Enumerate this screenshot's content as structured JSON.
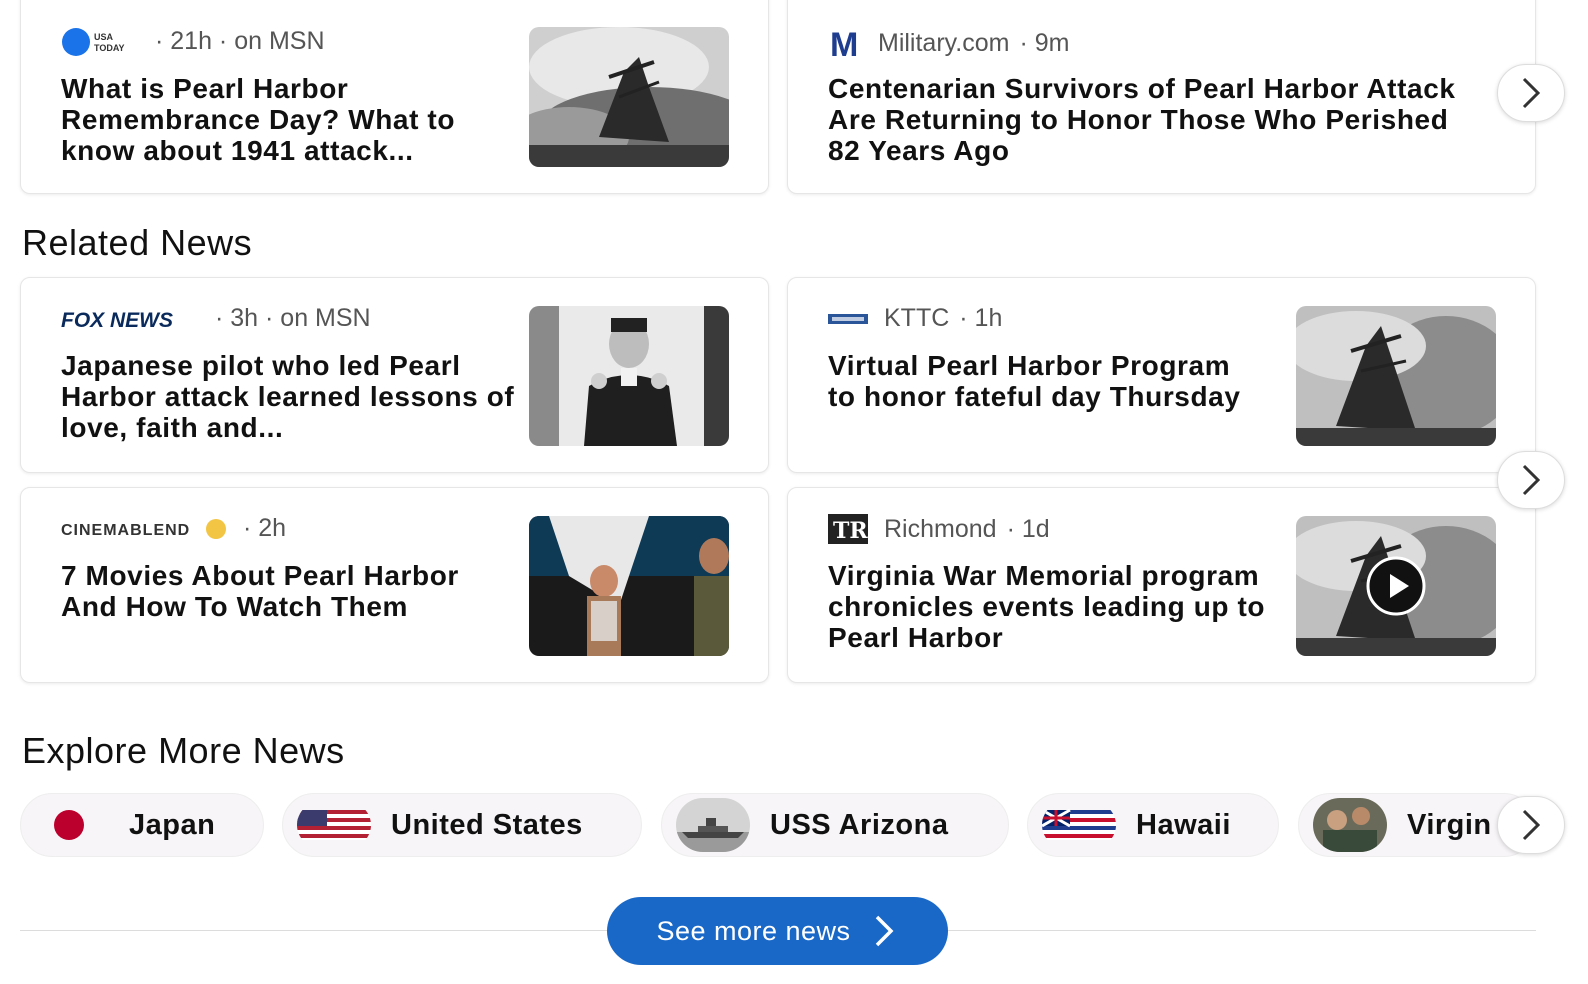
{
  "top_row": [
    {
      "source": "USA TODAY",
      "logo_icon": "usa-today-logo-icon",
      "meta": "· 21h · on MSN",
      "headline": "What is Pearl Harbor Remembrance Day? What to know about 1941 attack..."
    },
    {
      "source": "Military.com",
      "logo_icon": "military-m-logo-icon",
      "meta": "· 9m",
      "headline": "Centenarian Survivors of Pearl Harbor Attack Are Returning to Honor Those Who Perished 82 Years Ago"
    }
  ],
  "related_news": {
    "title": "Related News",
    "cards": [
      {
        "source": "FOX NEWS",
        "logo_icon": "fox-news-logo-icon",
        "meta": "· 3h · on MSN",
        "headline": "Japanese pilot who led Pearl Harbor attack learned lessons of love, faith and..."
      },
      {
        "source": "KTTC",
        "logo_icon": "kttc-logo-icon",
        "meta": "· 1h",
        "headline": "Virtual Pearl Harbor Program to honor fateful day Thursday"
      },
      {
        "source": "CINEMABLEND",
        "logo_icon": "cinemablend-logo-icon",
        "meta": "· 2h",
        "headline": "7 Movies About Pearl Harbor And How To Watch Them"
      },
      {
        "source": "Richmond",
        "logo_icon": "richmond-logo-icon",
        "meta": "· 1d",
        "headline": "Virginia War Memorial program chronicles events leading up to Pearl Harbor"
      }
    ]
  },
  "explore": {
    "title": "Explore More News",
    "chips": [
      {
        "label": "Japan",
        "icon": "japan-flag-icon"
      },
      {
        "label": "United States",
        "icon": "us-flag-icon"
      },
      {
        "label": "USS Arizona",
        "icon": "battleship-icon"
      },
      {
        "label": "Hawaii",
        "icon": "hawaii-flag-icon"
      },
      {
        "label": "Virgin",
        "icon": "virginia-photo-icon"
      }
    ]
  },
  "see_more": {
    "label": "See more news"
  },
  "colors": {
    "accent_blue": "#1968c8",
    "usa_today_blue": "#1a73e8",
    "military_blue": "#1f3d8f",
    "japan_red": "#bc002d"
  }
}
